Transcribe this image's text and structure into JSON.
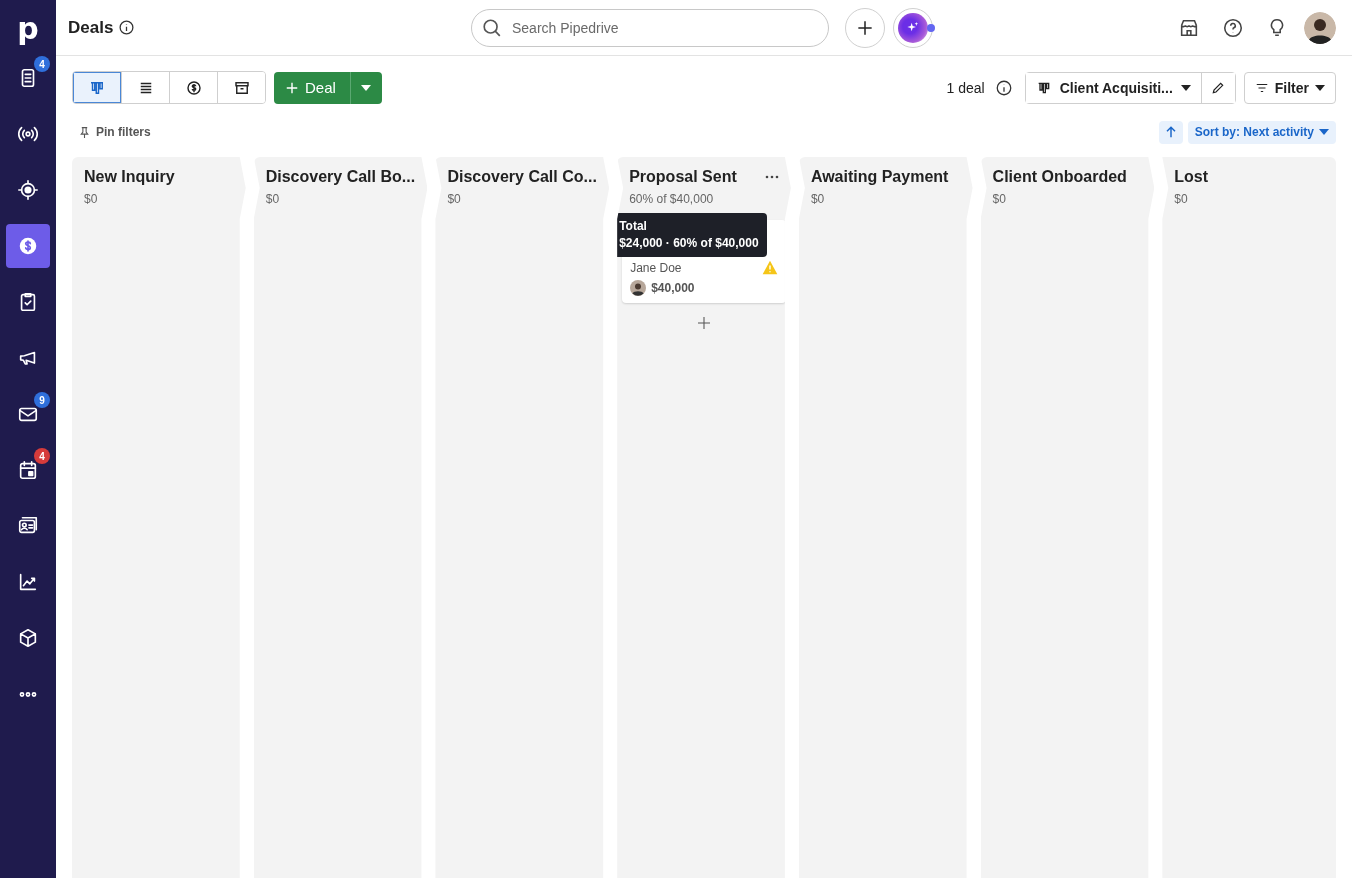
{
  "logo": "p",
  "sidebar": {
    "items": [
      {
        "selected": false,
        "badge": "4",
        "color": "#2f6fdb"
      },
      {
        "selected": false
      },
      {
        "selected": false
      },
      {
        "selected": true
      },
      {
        "selected": false
      },
      {
        "selected": false
      },
      {
        "selected": false,
        "badge": "9",
        "color": "#2f6fdb"
      },
      {
        "selected": false,
        "badge": "4",
        "color": "#d63b3b"
      },
      {
        "selected": false
      },
      {
        "selected": false
      },
      {
        "selected": false
      },
      {
        "selected": false
      }
    ]
  },
  "header": {
    "title": "Deals",
    "search": {
      "placeholder": "Search Pipedrive"
    }
  },
  "toolbar": {
    "views": [
      {
        "selected": true
      },
      {
        "selected": false
      },
      {
        "selected": false
      },
      {
        "selected": false
      }
    ],
    "add_button": "Deal",
    "deal_count": "1 deal",
    "pipeline": "Client Acquisiti...",
    "filter": "Filter",
    "pin_filters": "Pin filters",
    "sort": "Sort by: Next activity"
  },
  "columns": [
    {
      "name": "New Inquiry",
      "amount": "$0"
    },
    {
      "name": "Discovery Call Bo...",
      "amount": "$0"
    },
    {
      "name": "Discovery Call Co...",
      "amount": "$0"
    },
    {
      "name": "Proposal Sent",
      "amount": "60% of $40,000",
      "more_menu": true,
      "add_button": true,
      "tooltip": {
        "title": "Total",
        "text": "$24,000 · 60% of $40,000"
      },
      "deals": [
        {
          "person": "Jane Doe",
          "value": "$40,000",
          "warning": true
        }
      ]
    },
    {
      "name": "Awaiting Payment",
      "amount": "$0"
    },
    {
      "name": "Client Onboarded",
      "amount": "$0"
    },
    {
      "name": "Lost",
      "amount": "$0"
    }
  ]
}
